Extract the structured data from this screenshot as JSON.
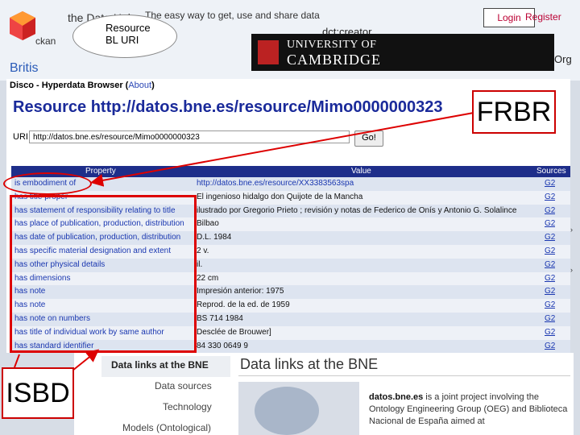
{
  "background": {
    "ckan_label": "ckan",
    "datahub_title": "the Data Hub",
    "tagline": "The easy way to get, use and share data",
    "login": "Login",
    "register": "Register",
    "graph_node_label_1": "Resource",
    "graph_node_label_2": "BL URI",
    "dct_label": "dct:creator",
    "cambridge_line1": "UNIVERSITY OF",
    "cambridge_line2": "CAMBRIDGE",
    "org_fragment": "Org",
    "britis_fragment": "Britis"
  },
  "browser": {
    "title_prefix": "Disco - Hyperdata Browser (",
    "about_link": "About",
    "title_suffix": ")",
    "resource_title": "Resource http://datos.bne.es/resource/Mimo0000000323",
    "uri_label": "URI:",
    "uri_value": "http://datos.bne.es/resource/Mimo0000000323",
    "go_button": "Go!",
    "columns": {
      "property": "Property",
      "value": "Value",
      "sources": "Sources"
    },
    "rows": [
      {
        "property": "is embodiment of",
        "value": "http://datos.bne.es/resource/XX3383563spa",
        "source": "G2"
      },
      {
        "property": "has title proper",
        "value": "El ingenioso hidalgo don Quijote de la Mancha",
        "source": "G2"
      },
      {
        "property": "has statement of responsibility relating to title",
        "value": "ilustrado por Gregorio Prieto ; revisión y notas de Federico de Onís y Antonio G. Solalince",
        "source": "G2"
      },
      {
        "property": "has place of publication, production, distribution",
        "value": "Bilbao",
        "source": "G2"
      },
      {
        "property": "has date of publication, production, distribution",
        "value": "D.L. 1984",
        "source": "G2"
      },
      {
        "property": "has specific material designation and extent",
        "value": "2 v.",
        "source": "G2"
      },
      {
        "property": "has other physical details",
        "value": "il.",
        "source": "G2"
      },
      {
        "property": "has dimensions",
        "value": "22 cm",
        "source": "G2"
      },
      {
        "property": "has note",
        "value": "Impresión anterior: 1975",
        "source": "G2"
      },
      {
        "property": "has note",
        "value": "Reprod. de la ed. de 1959",
        "source": "G2"
      },
      {
        "property": "has note on numbers",
        "value": "BS 714 1984",
        "source": "G2"
      },
      {
        "property": "has title of individual work by same author",
        "value": "Desclée de Brouwer]",
        "source": "G2"
      },
      {
        "property": "has standard identifier",
        "value": "84 330 0649 9",
        "source": "G2"
      }
    ]
  },
  "annotations": {
    "frbr": "FRBR",
    "isbd": "ISBD",
    "highlight_color": "#d00000"
  },
  "bne_page": {
    "nav_active": "Data links at the BNE",
    "nav_2": "Data sources",
    "nav_3": "Technology",
    "nav_4": "Models (Ontological)",
    "heading": "Data links at the BNE",
    "desc_strong": "datos.bne.es",
    "desc_rest": " is a joint project involving the Ontology Engineering Group (OEG) and Biblioteca Nacional de España aimed at"
  }
}
